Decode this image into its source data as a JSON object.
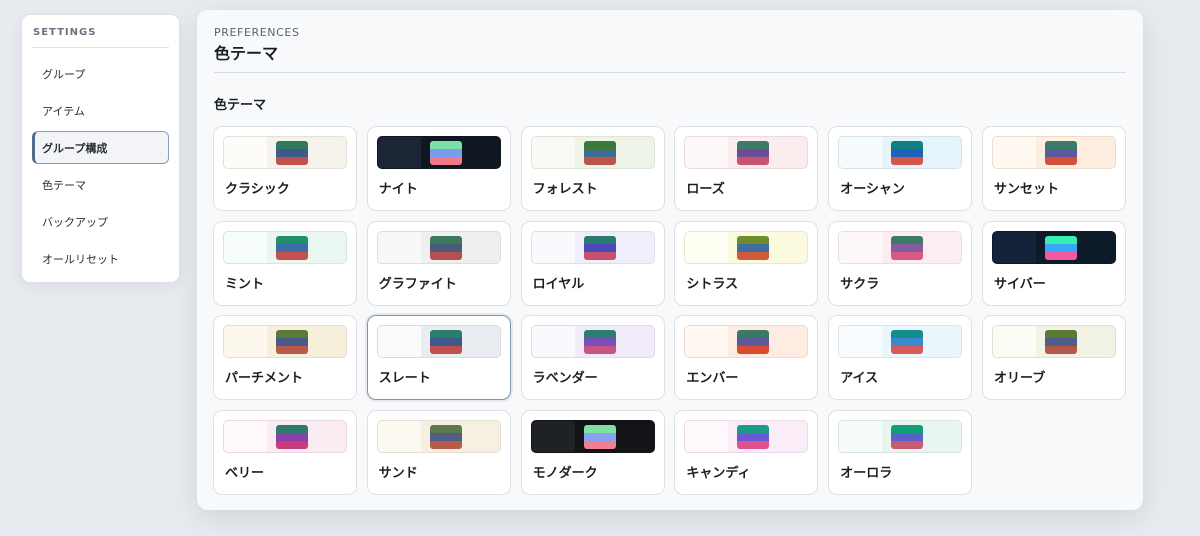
{
  "sidebar": {
    "title": "SETTINGS",
    "items": [
      {
        "label": "グループ",
        "active": false
      },
      {
        "label": "アイテム",
        "active": false
      },
      {
        "label": "グループ構成",
        "active": true
      },
      {
        "label": "色テーマ",
        "active": false
      },
      {
        "label": "バックアップ",
        "active": false
      },
      {
        "label": "オールリセット",
        "active": false
      }
    ]
  },
  "header": {
    "kicker": "PREFERENCES",
    "title": "色テーマ"
  },
  "section": {
    "title": "色テーマ"
  },
  "themes": [
    {
      "id": "classic",
      "label": "クラシック",
      "selected": false,
      "bg": "#f5f3ec",
      "left": "#fdfcf8",
      "top": "#2f7a5e",
      "mid": "#3a5a8c",
      "bot": "#c0504d"
    },
    {
      "id": "night",
      "label": "ナイト",
      "selected": false,
      "bg": "#0f1722",
      "left": "#1c2534",
      "top": "#7be0a5",
      "mid": "#7a9cf0",
      "bot": "#f07a8a"
    },
    {
      "id": "forest",
      "label": "フォレスト",
      "selected": false,
      "bg": "#eef5e8",
      "left": "#f8fbf5",
      "top": "#3c7a3a",
      "mid": "#3f6b8c",
      "bot": "#b8574a"
    },
    {
      "id": "rose",
      "label": "ローズ",
      "selected": false,
      "bg": "#fbecee",
      "left": "#fff8f8",
      "top": "#3e7a6a",
      "mid": "#6b4c98",
      "bot": "#c8546e"
    },
    {
      "id": "ocean",
      "label": "オーシャン",
      "selected": false,
      "bg": "#e6f4fb",
      "left": "#f6fbfe",
      "top": "#127e86",
      "mid": "#1d63b8",
      "bot": "#d6554a"
    },
    {
      "id": "sunset",
      "label": "サンセット",
      "selected": false,
      "bg": "#fdeee0",
      "left": "#fff9f2",
      "top": "#3c7a6a",
      "mid": "#5a5a9c",
      "bot": "#d4503a"
    },
    {
      "id": "mint",
      "label": "ミント",
      "selected": false,
      "bg": "#eaf7f1",
      "left": "#f7fdfa",
      "top": "#1f9068",
      "mid": "#3a6ea8",
      "bot": "#c55050"
    },
    {
      "id": "graphite",
      "label": "グラファイト",
      "selected": false,
      "bg": "#eeeff0",
      "left": "#f8f8f9",
      "top": "#3b7a5b",
      "mid": "#4a5a78",
      "bot": "#b55050"
    },
    {
      "id": "royal",
      "label": "ロイヤル",
      "selected": false,
      "bg": "#efeefa",
      "left": "#fafafe",
      "top": "#2a7c70",
      "mid": "#4e48b8",
      "bot": "#c4506e"
    },
    {
      "id": "citrus",
      "label": "シトラス",
      "selected": false,
      "bg": "#fbfadf",
      "left": "#fefef3",
      "top": "#6d8c2a",
      "mid": "#3f6fa0",
      "bot": "#d05a3a"
    },
    {
      "id": "sakura",
      "label": "サクラ",
      "selected": false,
      "bg": "#fcedf2",
      "left": "#fff8fb",
      "top": "#3c7c66",
      "mid": "#8a5aa0",
      "bot": "#d85a80"
    },
    {
      "id": "cyber",
      "label": "サイバー",
      "selected": false,
      "bg": "#0d1a2a",
      "left": "#13243a",
      "top": "#36f0b0",
      "mid": "#39a8f8",
      "bot": "#f05aa0"
    },
    {
      "id": "parchment",
      "label": "パーチメント",
      "selected": false,
      "bg": "#f6efdc",
      "left": "#fcf8ee",
      "top": "#5a7a3a",
      "mid": "#4a5a88",
      "bot": "#b85a4a"
    },
    {
      "id": "slate",
      "label": "スレート",
      "selected": true,
      "bg": "#e9edf1",
      "left": "#fafbfc",
      "top": "#2e7d6a",
      "mid": "#3e5a8c",
      "bot": "#c05050"
    },
    {
      "id": "lavender",
      "label": "ラベンダー",
      "selected": false,
      "bg": "#f2ecfa",
      "left": "#fbf9fe",
      "top": "#2a8070",
      "mid": "#7a4eb8",
      "bot": "#c85480"
    },
    {
      "id": "ember",
      "label": "エンバー",
      "selected": false,
      "bg": "#fdece2",
      "left": "#fff8f3",
      "top": "#3a7a62",
      "mid": "#5c5a98",
      "bot": "#dc4a30"
    },
    {
      "id": "ice",
      "label": "アイス",
      "selected": false,
      "bg": "#eaf6fb",
      "left": "#f8fcfe",
      "top": "#138c8a",
      "mid": "#3a8ad0",
      "bot": "#d65a5a"
    },
    {
      "id": "olive",
      "label": "オリーブ",
      "selected": false,
      "bg": "#f2f3e4",
      "left": "#fbfcf5",
      "top": "#5c7a32",
      "mid": "#4f5e88",
      "bot": "#b4584a"
    },
    {
      "id": "berry",
      "label": "ベリー",
      "selected": false,
      "bg": "#fbebf3",
      "left": "#fff8fc",
      "top": "#2a7c6c",
      "mid": "#8a40a8",
      "bot": "#c83a7a"
    },
    {
      "id": "sand",
      "label": "サンド",
      "selected": false,
      "bg": "#f6f0e2",
      "left": "#fcf9f1",
      "top": "#5a7a4a",
      "mid": "#4e5e86",
      "bot": "#b85a48"
    },
    {
      "id": "mono-dark",
      "label": "モノダーク",
      "selected": false,
      "bg": "#121418",
      "left": "#1e2126",
      "top": "#7fe0a0",
      "mid": "#8aa0f0",
      "bot": "#f08090"
    },
    {
      "id": "candy",
      "label": "キャンディ",
      "selected": false,
      "bg": "#fbedf8",
      "left": "#fff8fd",
      "top": "#1e9a8a",
      "mid": "#6a5ad8",
      "bot": "#e0508a"
    },
    {
      "id": "aurora",
      "label": "オーロラ",
      "selected": false,
      "bg": "#e8f6f0",
      "left": "#f7fcfa",
      "top": "#12a07a",
      "mid": "#5a62c8",
      "bot": "#c85a70"
    }
  ]
}
